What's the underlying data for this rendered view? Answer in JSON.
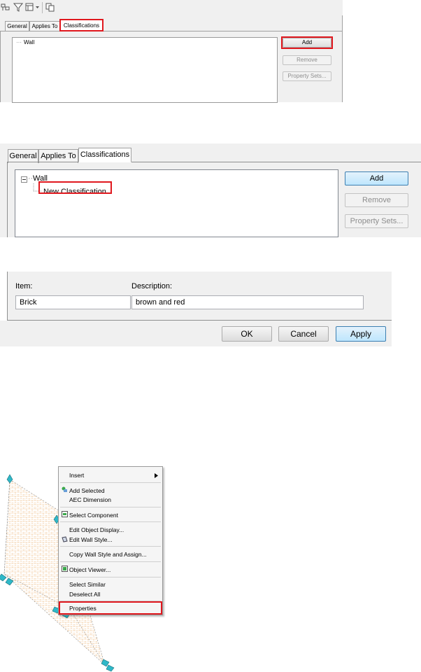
{
  "panel1": {
    "tabs": [
      "General",
      "Applies To",
      "Classifications"
    ],
    "tree_item": "Wall",
    "buttons": {
      "add": "Add",
      "remove": "Remove",
      "property_sets": "Property Sets..."
    }
  },
  "panel2": {
    "tabs": [
      "General",
      "Applies To",
      "Classifications"
    ],
    "tree_root": "Wall",
    "tree_child": "New Classification",
    "buttons": {
      "add": "Add",
      "remove": "Remove",
      "property_sets": "Property Sets..."
    }
  },
  "panel3": {
    "item_label": "Item:",
    "item_value": "Brick",
    "description_label": "Description:",
    "description_value": "brown and red",
    "buttons": {
      "ok": "OK",
      "cancel": "Cancel",
      "apply": "Apply"
    }
  },
  "context_menu": {
    "insert": "Insert",
    "add_selected_1": "Add Selected",
    "add_selected_2": "AEC Dimension",
    "select_component": "Select Component",
    "edit_object_display": "Edit Object Display...",
    "edit_wall_style": "Edit Wall Style...",
    "copy_wall_style": "Copy Wall Style and Assign...",
    "object_viewer": "Object Viewer...",
    "select_similar": "Select Similar",
    "deselect_all": "Deselect All",
    "properties": "Properties"
  },
  "colors": {
    "highlight": "#e0181e",
    "grip": "#2fb8c8",
    "hatch": "#e8a050"
  }
}
